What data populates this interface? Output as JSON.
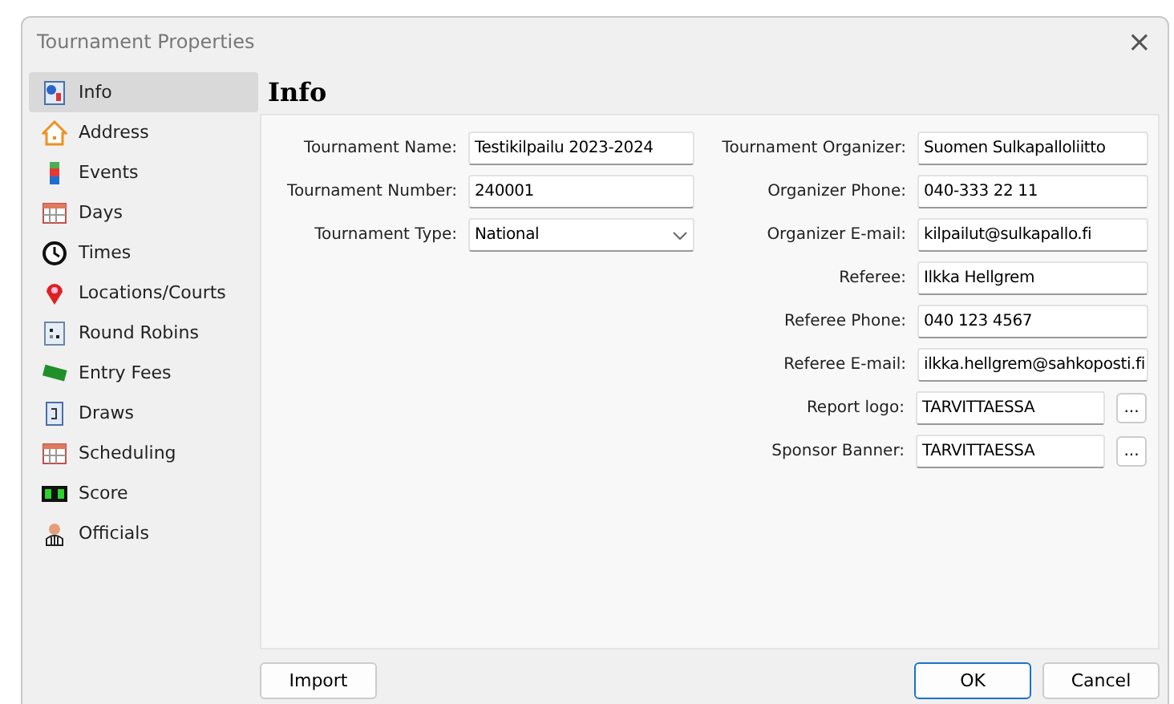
{
  "window": {
    "title": "Tournament Properties",
    "close": "×"
  },
  "sidebar": {
    "items": [
      {
        "label": "Info",
        "selected": true
      },
      {
        "label": "Address",
        "selected": false
      },
      {
        "label": "Events",
        "selected": false
      },
      {
        "label": "Days",
        "selected": false
      },
      {
        "label": "Times",
        "selected": false
      },
      {
        "label": "Locations/Courts",
        "selected": false
      },
      {
        "label": "Round Robins",
        "selected": false
      },
      {
        "label": "Entry Fees",
        "selected": false
      },
      {
        "label": "Draws",
        "selected": false
      },
      {
        "label": "Scheduling",
        "selected": false
      },
      {
        "label": "Score",
        "selected": false
      },
      {
        "label": "Officials",
        "selected": false
      }
    ]
  },
  "panel": {
    "heading": "Info",
    "left_fields": [
      {
        "kind": "text",
        "label": "Tournament Name:",
        "value": "Testikilpailu 2023-2024"
      },
      {
        "kind": "text",
        "label": "Tournament Number:",
        "value": "240001"
      },
      {
        "kind": "dropdown",
        "label": "Tournament Type:",
        "value": "National"
      }
    ],
    "right_fields": [
      {
        "kind": "text",
        "label": "Tournament Organizer:",
        "value": "Suomen Sulkapalloliitto"
      },
      {
        "kind": "text",
        "label": "Organizer Phone:",
        "value": "040-333 22 11"
      },
      {
        "kind": "text",
        "label": "Organizer E-mail:",
        "value": "kilpailut@sulkapallo.fi"
      },
      {
        "kind": "text",
        "label": "Referee:",
        "value": "Ilkka Hellgrem"
      },
      {
        "kind": "text",
        "label": "Referee Phone:",
        "value": "040 123 4567"
      },
      {
        "kind": "text",
        "label": "Referee E-mail:",
        "value": "ilkka.hellgrem@sahkoposti.fi"
      },
      {
        "kind": "file",
        "label": "Report logo:",
        "value": "TARVITTAESSA",
        "button": "..."
      },
      {
        "kind": "file",
        "label": "Sponsor Banner:",
        "value": "TARVITTAESSA",
        "button": "..."
      }
    ]
  },
  "buttons": {
    "left": "Import",
    "ok": "OK",
    "cancel": "Cancel"
  }
}
